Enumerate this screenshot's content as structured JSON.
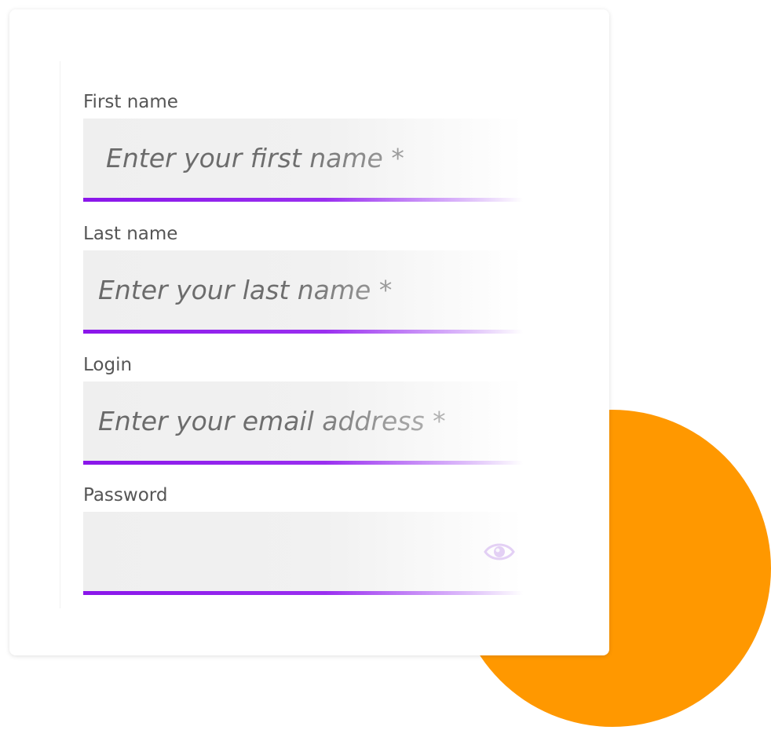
{
  "form": {
    "first_name": {
      "label": "First name",
      "placeholder": "Enter your first name *"
    },
    "last_name": {
      "label": "Last name",
      "placeholder": "Enter your last name *"
    },
    "login": {
      "label": "Login",
      "placeholder": "Enter your email address *"
    },
    "password": {
      "label": "Password",
      "placeholder": "",
      "toggle_icon": "eye-icon"
    }
  },
  "colors": {
    "accent": "#8A16EA",
    "decoration": "#FF9800",
    "input_background": "#EFEFEF"
  }
}
